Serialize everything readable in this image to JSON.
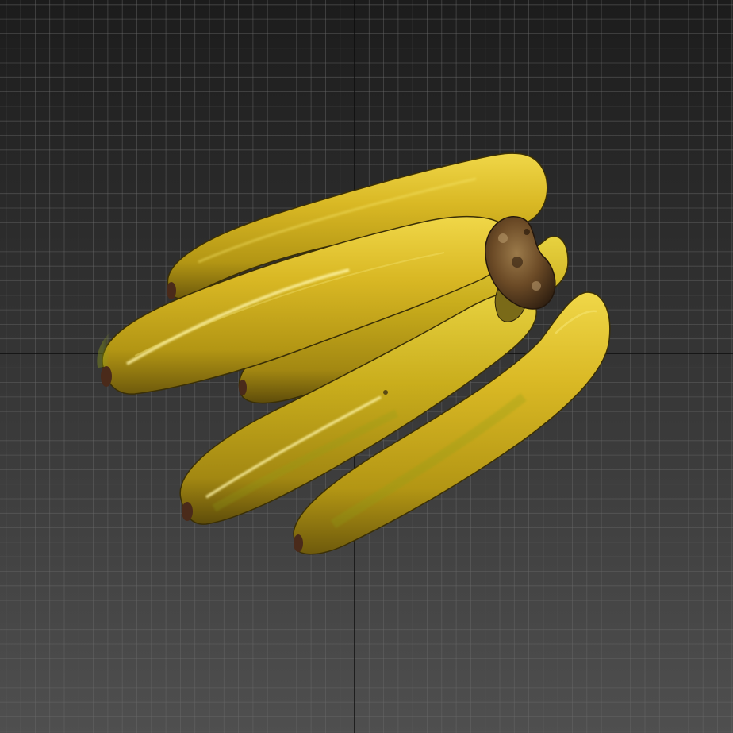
{
  "viewport": {
    "view": "perspective",
    "background_top": "#1c1c1c",
    "background_bottom": "#4f4f4f",
    "grid_color": "#6a6a6a",
    "axis_color": "#0c0c0c",
    "grid_visible": true
  },
  "scene_object": {
    "name": "banana-bunch",
    "banana_count": 5,
    "peel_color": "#d4b41f",
    "peel_highlight": "#f1dc4a",
    "peel_shadow": "#7a6410",
    "tip_color": "#4a2a1a",
    "stem_color": "#6b4a26"
  }
}
